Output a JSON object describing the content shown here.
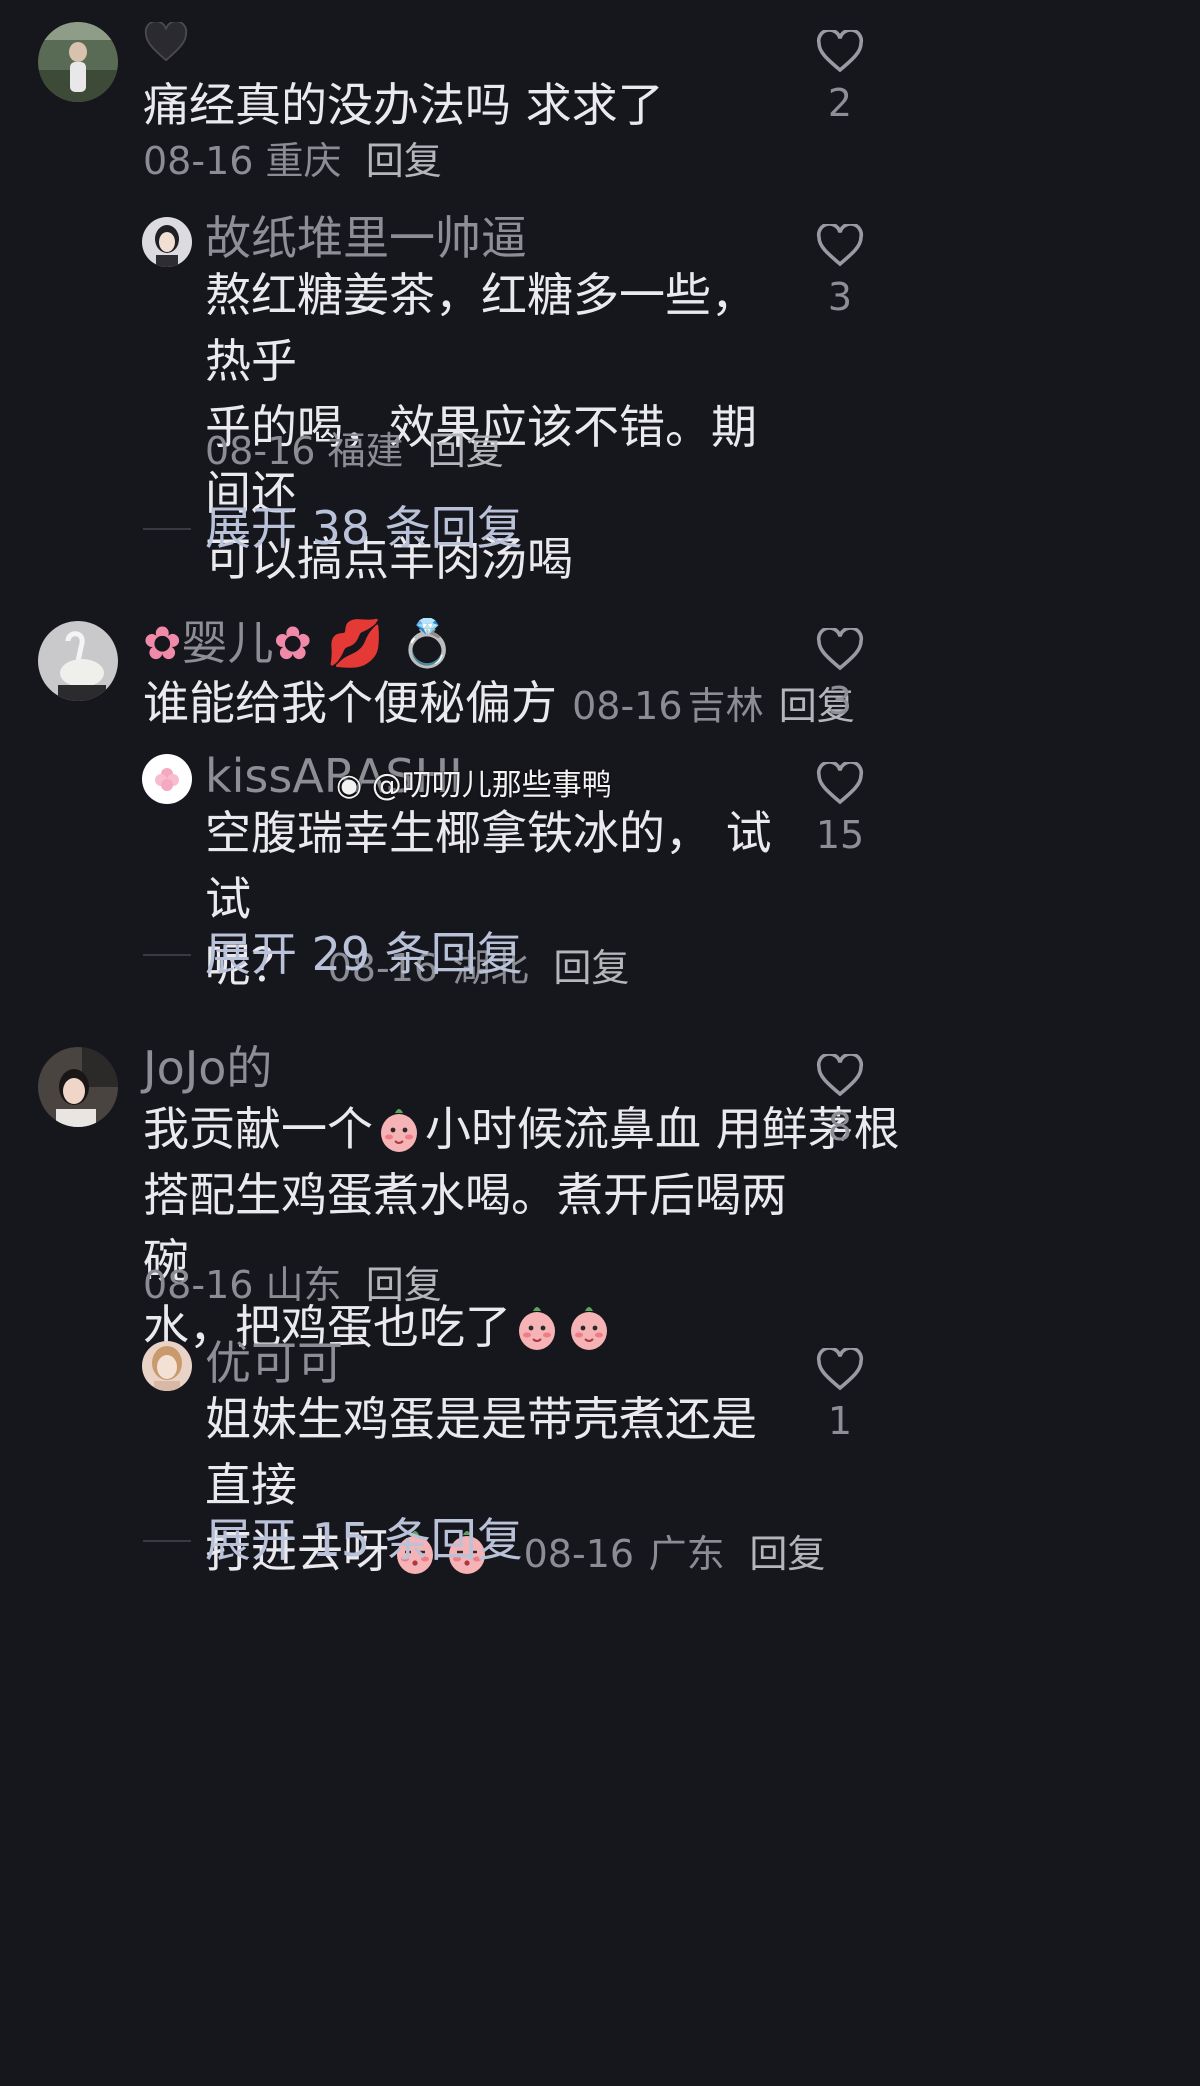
{
  "comments": [
    {
      "name": "",
      "badge_icon": "heart-icon",
      "text": "痛经真的没办法吗 求求了",
      "date": "08-16",
      "location": "重庆",
      "reply_label": "回复",
      "likes": "2",
      "replies": [
        {
          "name": "故纸堆里一帅逼",
          "text_lines": [
            "熬红糖姜茶，红糖多一些，热乎",
            "乎的喝，效果应该不错。期间还",
            "可以搞点羊肉汤喝"
          ],
          "date": "08-16",
          "location": "福建",
          "reply_label": "回复",
          "likes": "3"
        }
      ],
      "expand_label": "展开 38 条回复"
    },
    {
      "name": "婴儿",
      "name_emojis": [
        "flower-icon",
        "flower-icon",
        "lips-icon",
        "ring-icon"
      ],
      "text": "谁能给我个便秘偏方",
      "date": "08-16",
      "location": "吉林",
      "reply_label": "回复",
      "likes": "3",
      "replies": [
        {
          "name": "kissARASHI",
          "text_lines": [
            "空腹瑞幸生椰拿铁冰的， 试试",
            "呢？"
          ],
          "date": "08-16",
          "location": "湖北",
          "reply_label": "回复",
          "likes": "15"
        }
      ],
      "expand_label": "展开 29 条回复"
    },
    {
      "name": "JoJo的",
      "text_lines": [
        "我贡献一个",
        "小时候流鼻血 用鲜茅根",
        "搭配生鸡蛋煮水喝。煮开后喝两碗",
        "水，把鸡蛋也吃了"
      ],
      "date": "08-16",
      "location": "山东",
      "reply_label": "回复",
      "likes": "8",
      "replies": [
        {
          "name": "优可可",
          "text_lines": [
            "姐妹生鸡蛋是是带壳煮还是直接",
            "打进去呀"
          ],
          "date": "08-16",
          "location": "广东",
          "reply_label": "回复",
          "likes": "1"
        }
      ],
      "expand_label": "展开 15 条回复"
    }
  ],
  "watermark": "@叨叨儿那些事鸭",
  "colors": {
    "background": "#16161d",
    "text": "#e9e9ee",
    "muted": "#8e8e96",
    "expand": "#b9c2d8"
  }
}
